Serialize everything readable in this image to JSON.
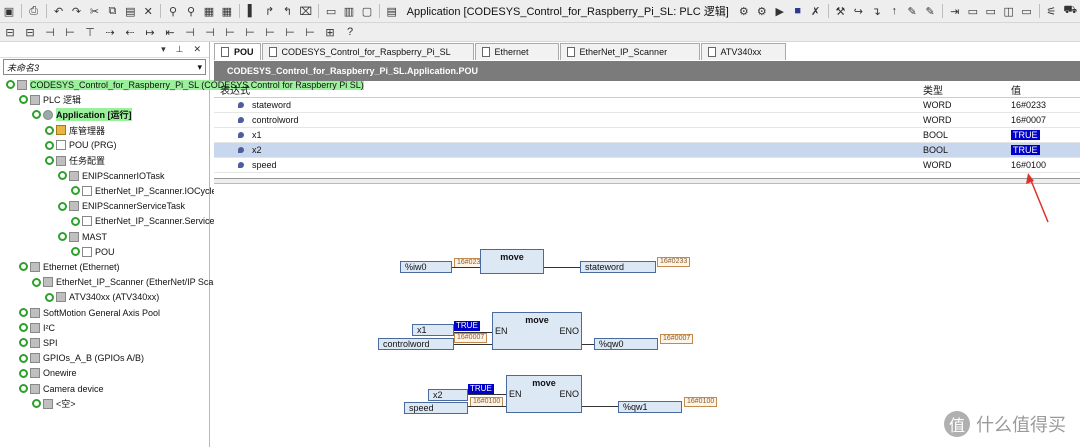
{
  "window": {
    "title": "Application [CODESYS_Control_for_Raspberry_Pi_SL: PLC 逻辑]"
  },
  "left_panel": {
    "header_buttons": [
      "▾",
      "⊥",
      "✕"
    ],
    "project": "未命名3"
  },
  "tree": [
    {
      "label": "CODESYS_Control_for_Raspberry_Pi_SL (CODESYS Control for Raspberry Pi SL)",
      "indent": 0,
      "hl": true
    },
    {
      "label": "PLC 逻辑",
      "indent": 1
    },
    {
      "label": "Application [运行]",
      "indent": 2,
      "hl": true,
      "bold": true
    },
    {
      "label": "库管理器",
      "indent": 3
    },
    {
      "label": "POU (PRG)",
      "indent": 3
    },
    {
      "label": "任务配置",
      "indent": 3
    },
    {
      "label": "ENIPScannerIOTask",
      "indent": 4
    },
    {
      "label": "EtherNet_IP_Scanner.IOCycle",
      "indent": 5
    },
    {
      "label": "ENIPScannerServiceTask",
      "indent": 4
    },
    {
      "label": "EtherNet_IP_Scanner.ServiceCycle",
      "indent": 5
    },
    {
      "label": "MAST",
      "indent": 4
    },
    {
      "label": "POU",
      "indent": 5
    },
    {
      "label": "Ethernet (Ethernet)",
      "indent": 1
    },
    {
      "label": "EtherNet_IP_Scanner (EtherNet/IP Scanner)",
      "indent": 2
    },
    {
      "label": "ATV340xx (ATV340xx)",
      "indent": 3
    },
    {
      "label": "SoftMotion General Axis Pool",
      "indent": 1
    },
    {
      "label": "I²C",
      "indent": 1
    },
    {
      "label": "SPI",
      "indent": 1
    },
    {
      "label": "GPIOs_A_B (GPIOs A/B)",
      "indent": 1
    },
    {
      "label": "Onewire",
      "indent": 1
    },
    {
      "label": "Camera device",
      "indent": 1
    },
    {
      "label": "<空>",
      "indent": 2
    }
  ],
  "tabs": [
    "POU",
    "CODESYS_Control_for_Raspberry_Pi_SL",
    "Ethernet",
    "EtherNet_IP_Scanner",
    "ATV340xx"
  ],
  "path": "CODESYS_Control_for_Raspberry_Pi_SL.Application.POU",
  "watch": {
    "headers": {
      "expr": "表达式",
      "type": "类型",
      "value": "值"
    },
    "rows": [
      {
        "expr": "stateword",
        "type": "WORD",
        "value": "16#0233",
        "true": false
      },
      {
        "expr": "controlword",
        "type": "WORD",
        "value": "16#0007",
        "true": false
      },
      {
        "expr": "x1",
        "type": "BOOL",
        "value": "TRUE",
        "true": true
      },
      {
        "expr": "x2",
        "type": "BOOL",
        "value": "TRUE",
        "true": true,
        "sel": true
      },
      {
        "expr": "speed",
        "type": "WORD",
        "value": "16#0100",
        "true": false
      }
    ]
  },
  "diagram": {
    "rung1": {
      "fb": "move",
      "in": "%iw0",
      "in_val": "16#0233",
      "out": "stateword",
      "out_val": "16#0233"
    },
    "rung2": {
      "fb": "move",
      "en": "EN",
      "eno": "ENO",
      "x": "x1",
      "x_val": "TRUE",
      "in": "controlword",
      "in_val": "16#0007",
      "out": "%qw0",
      "out_val": "16#0007"
    },
    "rung3": {
      "fb": "move",
      "en": "EN",
      "eno": "ENO",
      "x": "x2",
      "x_val": "TRUE",
      "in": "speed",
      "in_val": "16#0100",
      "out": "%qw1",
      "out_val": "16#0100"
    }
  },
  "watermark": "什么值得买",
  "accent": "#0000c8",
  "highlight": "#9bf09b"
}
